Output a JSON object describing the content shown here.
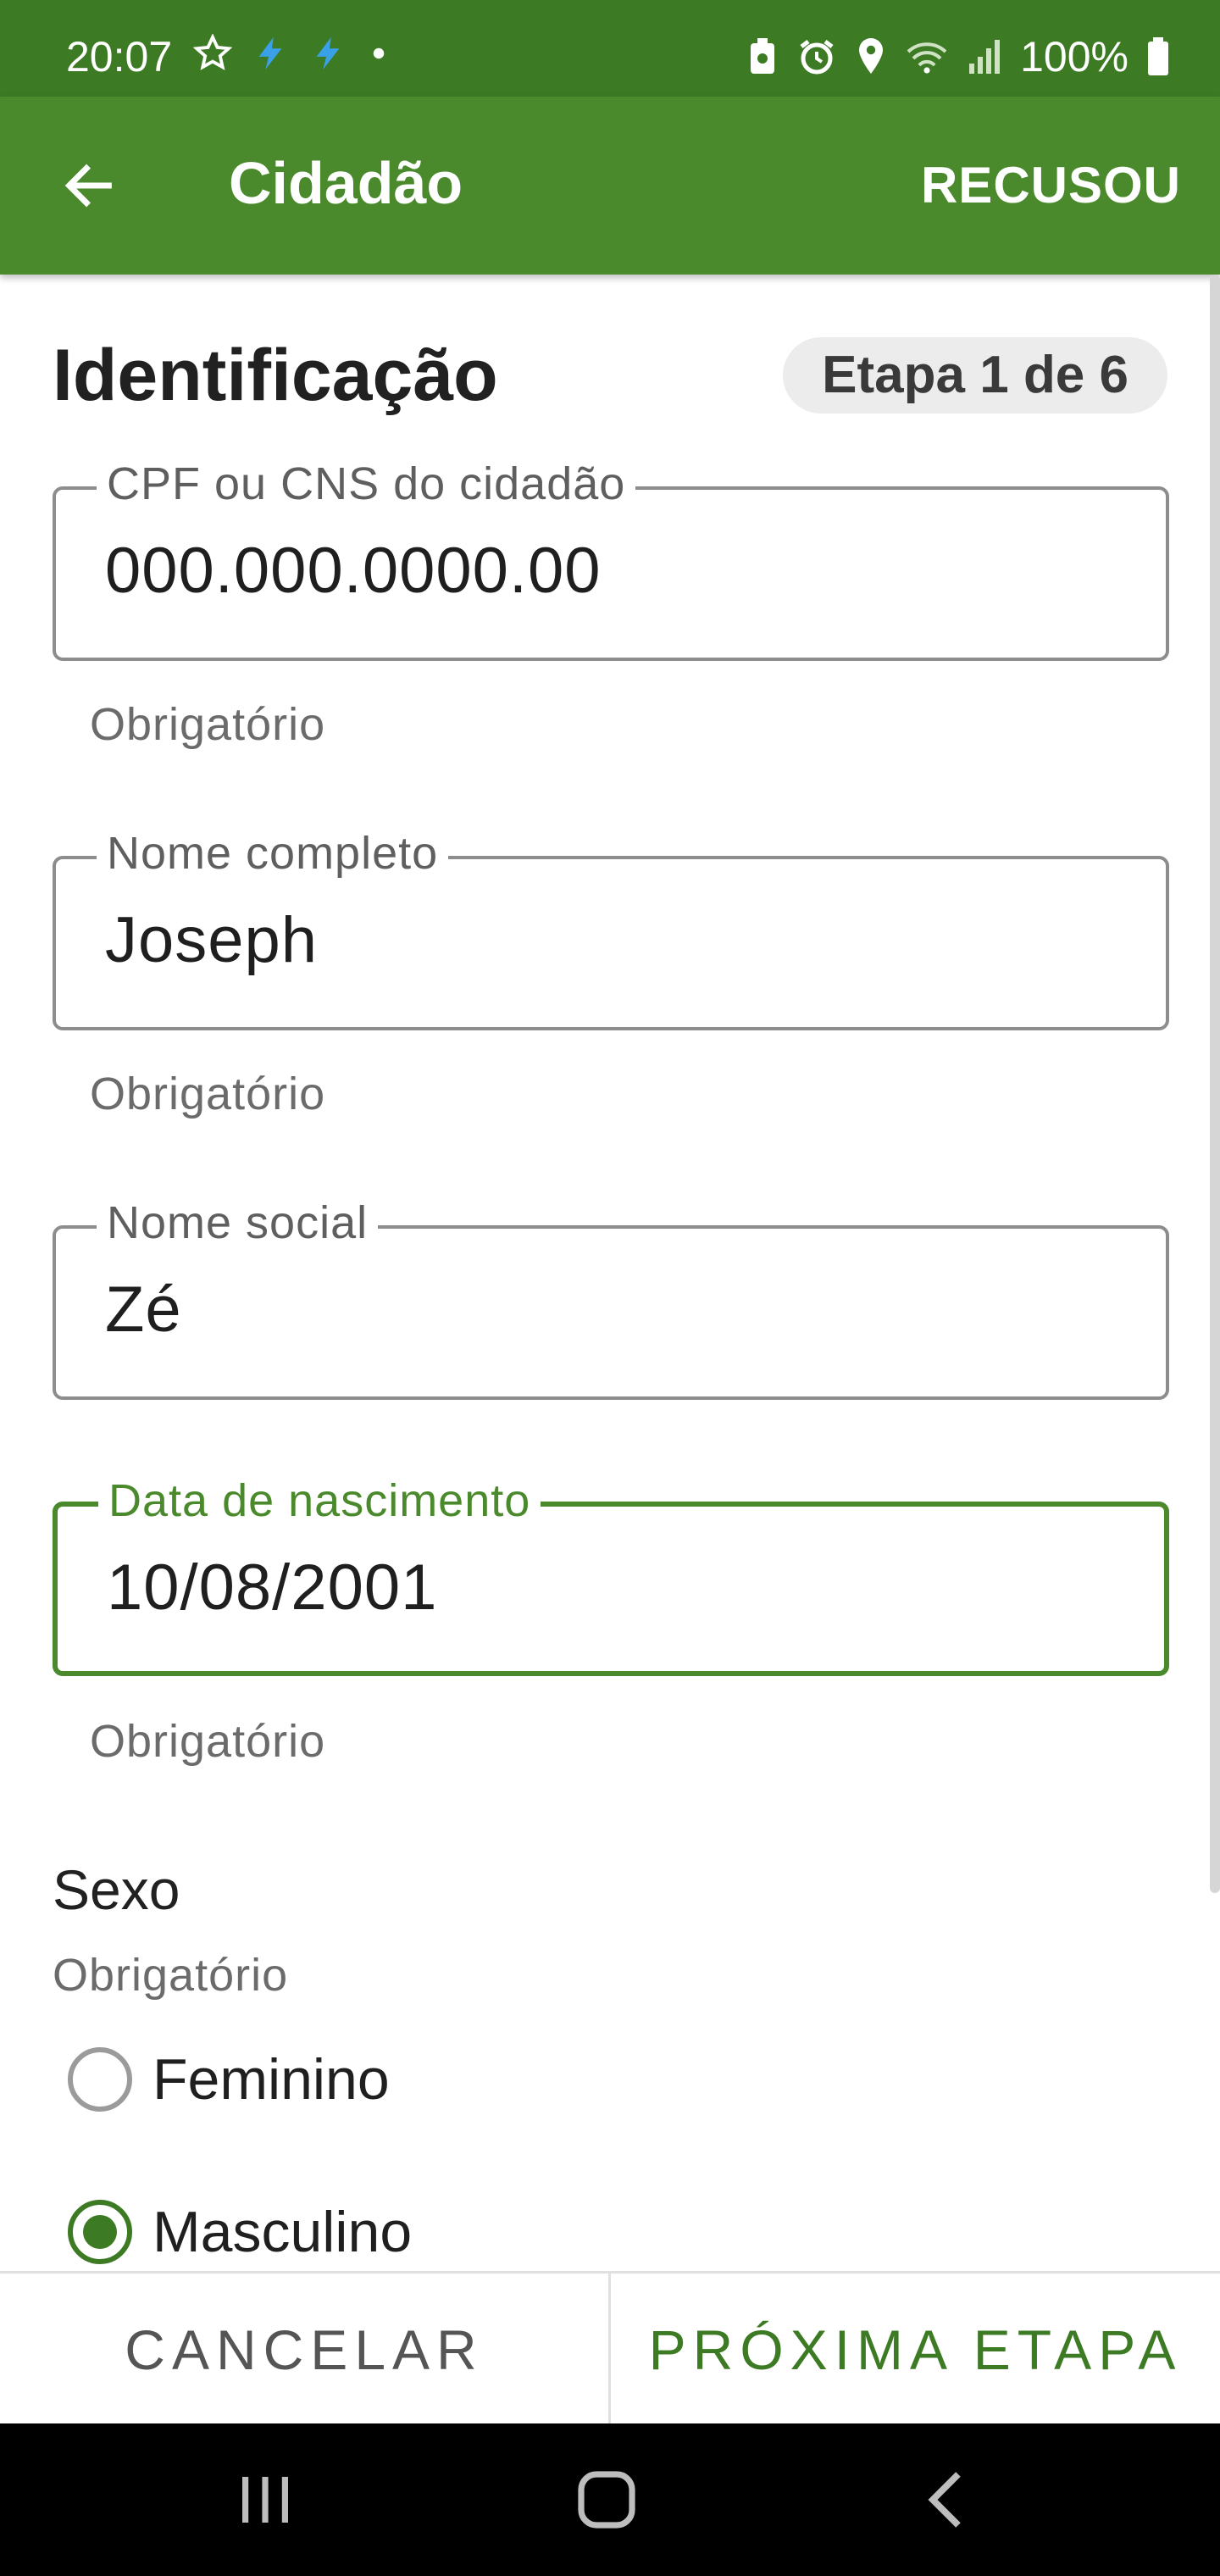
{
  "status_bar": {
    "time": "20:07",
    "battery_percent": "100%",
    "icons": [
      "star-icon",
      "bolt-icon",
      "bolt-icon",
      "dot-icon",
      "battery-saver-icon",
      "alarm-icon",
      "location-icon",
      "wifi-icon",
      "signal-icon",
      "battery-icon"
    ]
  },
  "app_bar": {
    "title": "Cidadão",
    "action_label": "RECUSOU",
    "color": "#4a8a2c"
  },
  "section": {
    "title": "Identificação",
    "step": "Etapa 1 de 6"
  },
  "fields": {
    "cpf": {
      "label": "CPF ou CNS do cidadão",
      "value": "000.000.0000.00",
      "helper": "Obrigatório"
    },
    "nome": {
      "label": "Nome completo",
      "value": "Joseph",
      "helper": "Obrigatório"
    },
    "nome_social": {
      "label": "Nome social",
      "value": "Zé"
    },
    "nascimento": {
      "label": "Data de nascimento",
      "value": "10/08/2001",
      "helper": "Obrigatório"
    }
  },
  "sexo": {
    "label": "Sexo",
    "helper": "Obrigatório",
    "options": [
      {
        "label": "Feminino",
        "selected": false
      },
      {
        "label": "Masculino",
        "selected": true
      }
    ]
  },
  "bottom_bar": {
    "cancel_label": "CANCELAR",
    "next_label": "PRÓXIMA ETAPA"
  },
  "accent_color": "#3d7a24"
}
